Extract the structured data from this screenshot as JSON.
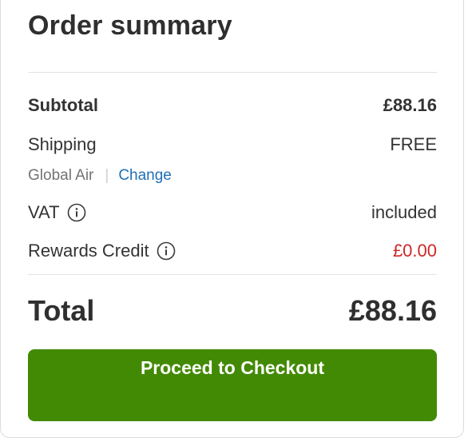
{
  "summary": {
    "title": "Order summary",
    "subtotal_label": "Subtotal",
    "subtotal_value": "£88.16",
    "shipping_label": "Shipping",
    "shipping_value": "FREE",
    "shipping_method": "Global Air",
    "separator": "|",
    "change_label": "Change",
    "vat_label": "VAT",
    "vat_value": "included",
    "rewards_label": "Rewards Credit",
    "rewards_value": "£0.00",
    "total_label": "Total",
    "total_value": "£88.16",
    "checkout_label": "Proceed to Checkout"
  },
  "colors": {
    "accent_green": "#438a04",
    "link_blue": "#1f6fb5",
    "credit_red": "#d02626"
  },
  "icons": {
    "vat_info": "info-circle-icon",
    "rewards_info": "info-circle-icon"
  }
}
